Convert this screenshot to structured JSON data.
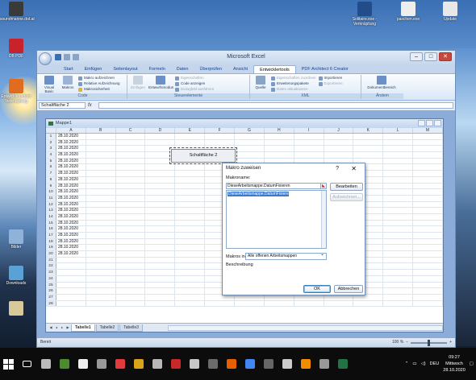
{
  "desktop": {
    "icons_left": [
      {
        "label": "soundmanne.dot.at",
        "color": "#3a3a3a"
      },
      {
        "label": "DB PDF",
        "color": "#c8232c"
      },
      {
        "label": "Entwicklerordner Verknüpfung",
        "color": "#e06d1f"
      },
      {
        "label": "Bilder",
        "color": "#8fb2d9"
      },
      {
        "label": "Downloads",
        "color": "#5aa1d5"
      },
      {
        "label": "",
        "color": "#d9c99a"
      }
    ],
    "icons_top": [
      {
        "label": "Solitaire.exe - Verknüpfung",
        "color": "#234c8a"
      },
      {
        "label": "paschen.exe",
        "color": "#eeeeee"
      },
      {
        "label": "Update",
        "color": "#e8e8e8"
      }
    ]
  },
  "window": {
    "title": "Microsoft Excel",
    "controls": [
      "–",
      "□",
      "✕"
    ],
    "tabs": [
      "Start",
      "Einfügen",
      "Seitenlayout",
      "Formeln",
      "Daten",
      "Überprüfen",
      "Ansicht",
      "Entwicklertools",
      "PDF Architect 6 Creator"
    ],
    "active_tab": "Entwicklertools",
    "ribbon": {
      "code": {
        "label": "Code",
        "visual_basic": "Visual Basic",
        "makros": "Makros",
        "items": [
          "Makro aufzeichnen",
          "Relative Aufzeichnung",
          "Makrosicherheit"
        ]
      },
      "controls": {
        "label": "Steuerelemente",
        "einfuegen": "Einfügen",
        "entwurfsmodus": "Entwurfsmodus",
        "items": [
          "Eigenschaften",
          "Code anzeigen",
          "Dialogfeld ausführen"
        ]
      },
      "xml": {
        "label": "XML",
        "quelle": "Quelle",
        "items": [
          "Eigenschaften zuordnen",
          "Erweiterungspakete",
          "Daten aktualisieren"
        ],
        "items2": [
          "Importieren",
          "Exportieren"
        ]
      },
      "aendern": {
        "label": "Ändern",
        "dokumentbereich": "Dokumentbereich"
      }
    },
    "namebox": "Schaltfläche 2",
    "fx": "fx",
    "status": "Bereit",
    "zoom": "100 %"
  },
  "workbook": {
    "title": "Mappe1",
    "columns": [
      "A",
      "B",
      "C",
      "D",
      "E",
      "F",
      "G",
      "H",
      "I",
      "J",
      "K",
      "L",
      "M"
    ],
    "rows": [
      {
        "n": "1",
        "a": "28.10.2020"
      },
      {
        "n": "2",
        "a": "28.10.2020"
      },
      {
        "n": "3",
        "a": "28.10.2020"
      },
      {
        "n": "4",
        "a": "28.10.2020"
      },
      {
        "n": "5",
        "a": "28.10.2020"
      },
      {
        "n": "6",
        "a": "28.10.2020"
      },
      {
        "n": "7",
        "a": "28.10.2020"
      },
      {
        "n": "8",
        "a": "28.10.2020"
      },
      {
        "n": "9",
        "a": "28.10.2020"
      },
      {
        "n": "10",
        "a": "28.10.2020"
      },
      {
        "n": "11",
        "a": "28.10.2020"
      },
      {
        "n": "12",
        "a": "28.10.2020"
      },
      {
        "n": "13",
        "a": "28.10.2020"
      },
      {
        "n": "14",
        "a": "28.10.2020"
      },
      {
        "n": "15",
        "a": "28.10.2020"
      },
      {
        "n": "16",
        "a": "28.10.2020"
      },
      {
        "n": "17",
        "a": "28.10.2020"
      },
      {
        "n": "18",
        "a": "28.10.2020"
      },
      {
        "n": "19",
        "a": "28.10.2020"
      },
      {
        "n": "20",
        "a": "28.10.2020"
      },
      {
        "n": "21",
        "a": ""
      },
      {
        "n": "22",
        "a": ""
      },
      {
        "n": "23",
        "a": ""
      },
      {
        "n": "24",
        "a": ""
      },
      {
        "n": "25",
        "a": ""
      },
      {
        "n": "26",
        "a": ""
      },
      {
        "n": "27",
        "a": ""
      },
      {
        "n": "28",
        "a": ""
      }
    ],
    "button_label": "Schaltfläche 2",
    "sheets": [
      "Tabelle1",
      "Tabelle2",
      "Tabelle3"
    ],
    "active_sheet": "Tabelle1"
  },
  "dialog": {
    "title": "Makro zuweisen",
    "help": "?",
    "close": "✕",
    "macro_name_label": "Makroname:",
    "macro_name_value": "DieseArbeitsmappe.DatumFixieren",
    "list": [
      "DieseArbeitsmappe.DatumFixieren"
    ],
    "edit_btn": "Bearbeiten",
    "record_btn": "Aufzeichnen...",
    "macros_in_label": "Makros in:",
    "macros_in_value": "Alle offenen Arbeitsmappen",
    "description_label": "Beschreibung",
    "ok": "OK",
    "cancel": "Abbrechen"
  },
  "taskbar": {
    "icons": [
      {
        "color": "#bbbbbb"
      },
      {
        "color": "#4c8c2e"
      },
      {
        "color": "#f0f0f0"
      },
      {
        "color": "#999999"
      },
      {
        "color": "#e33b3b"
      },
      {
        "color": "#d9a21b"
      },
      {
        "color": "#b8b8b8"
      },
      {
        "color": "#c92828"
      },
      {
        "color": "#c7c7c7"
      },
      {
        "color": "#6b6b6b"
      },
      {
        "color": "#e66000"
      },
      {
        "color": "#4285f4"
      },
      {
        "color": "#666666"
      },
      {
        "color": "#cccccc"
      },
      {
        "color": "#f28c00"
      },
      {
        "color": "#999999"
      },
      {
        "color": "#217346"
      }
    ],
    "lang": "DEU",
    "time": "09:27",
    "day": "Mittwoch",
    "date": "28.10.2020"
  }
}
